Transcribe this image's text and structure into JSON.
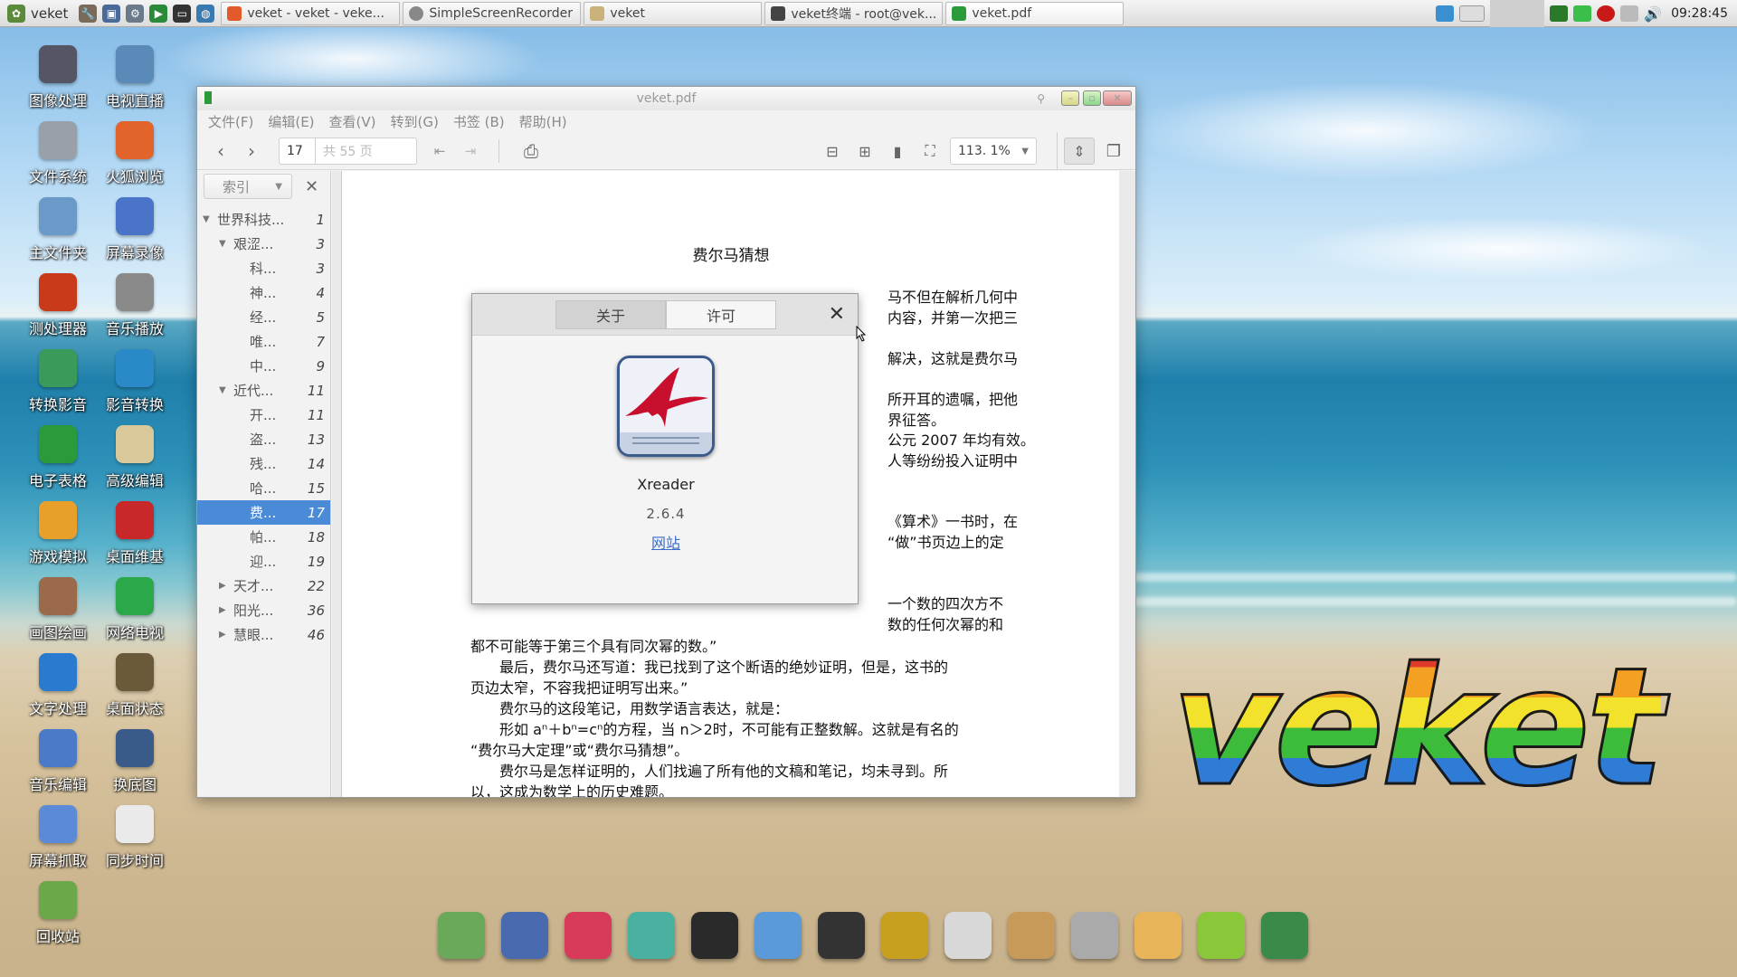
{
  "top_panel": {
    "start_label": "veket",
    "tasks": [
      {
        "label": "veket - veket - veke..."
      },
      {
        "label": "SimpleScreenRecorder"
      },
      {
        "label": "veket"
      },
      {
        "label": "veket终端 - root@vek..."
      },
      {
        "label": "veket.pdf"
      }
    ],
    "clock": "09:28:45"
  },
  "desktop_icons": [
    {
      "label": "图像处理",
      "icon": "image-editor-icon"
    },
    {
      "label": "电视直播",
      "icon": "tv-live-icon"
    },
    {
      "label": "文件系统",
      "icon": "drive-icon"
    },
    {
      "label": "火狐浏览",
      "icon": "firefox-icon"
    },
    {
      "label": "主文件夹",
      "icon": "home-folder-icon"
    },
    {
      "label": "屏幕录像",
      "icon": "screen-recorder-icon"
    },
    {
      "label": "测处理器",
      "icon": "cpu-test-icon"
    },
    {
      "label": "音乐播放",
      "icon": "music-player-icon"
    },
    {
      "label": "转换影音",
      "icon": "media-convert-icon"
    },
    {
      "label": "影音转换",
      "icon": "video-convert-icon"
    },
    {
      "label": "电子表格",
      "icon": "spreadsheet-icon"
    },
    {
      "label": "高级编辑",
      "icon": "text-editor-icon"
    },
    {
      "label": "游戏模拟",
      "icon": "game-emulator-icon"
    },
    {
      "label": "桌面维基",
      "icon": "desktop-wiki-icon"
    },
    {
      "label": "画图绘画",
      "icon": "paint-icon"
    },
    {
      "label": "网络电视",
      "icon": "network-tv-icon"
    },
    {
      "label": "文字处理",
      "icon": "word-processor-icon"
    },
    {
      "label": "桌面状态",
      "icon": "desktop-status-icon"
    },
    {
      "label": "音乐编辑",
      "icon": "audio-editor-icon"
    },
    {
      "label": "换底图",
      "icon": "wallpaper-icon"
    },
    {
      "label": "屏幕抓取",
      "icon": "screenshot-icon"
    },
    {
      "label": "同步时间",
      "icon": "calendar-sync-icon"
    },
    {
      "label": "回收站",
      "icon": "trash-icon"
    }
  ],
  "window": {
    "title": "veket.pdf",
    "menu": [
      "文件(F)",
      "编辑(E)",
      "查看(V)",
      "转到(G)",
      "书签 (B)",
      "帮助(H)"
    ],
    "toolbar": {
      "page_current": "17",
      "page_total": "共 55 页",
      "zoom": "113. 1%"
    },
    "sidebar": {
      "mode": "索引",
      "toc": [
        {
          "title": "世界科技...",
          "page": "1",
          "level": 0,
          "arrow": "▼"
        },
        {
          "title": "艰涩...",
          "page": "3",
          "level": 1,
          "arrow": "▼"
        },
        {
          "title": "科...",
          "page": "3",
          "level": 2,
          "arrow": ""
        },
        {
          "title": "神...",
          "page": "4",
          "level": 2,
          "arrow": ""
        },
        {
          "title": "经...",
          "page": "5",
          "level": 2,
          "arrow": ""
        },
        {
          "title": "唯...",
          "page": "7",
          "level": 2,
          "arrow": ""
        },
        {
          "title": "中...",
          "page": "9",
          "level": 2,
          "arrow": ""
        },
        {
          "title": "近代...",
          "page": "11",
          "level": 1,
          "arrow": "▼"
        },
        {
          "title": "开...",
          "page": "11",
          "level": 2,
          "arrow": ""
        },
        {
          "title": "盗...",
          "page": "13",
          "level": 2,
          "arrow": ""
        },
        {
          "title": "残...",
          "page": "14",
          "level": 2,
          "arrow": ""
        },
        {
          "title": "哈...",
          "page": "15",
          "level": 2,
          "arrow": ""
        },
        {
          "title": "费...",
          "page": "17",
          "level": 2,
          "arrow": "",
          "selected": true
        },
        {
          "title": "帕...",
          "page": "18",
          "level": 2,
          "arrow": ""
        },
        {
          "title": "迎...",
          "page": "19",
          "level": 2,
          "arrow": ""
        },
        {
          "title": "天才...",
          "page": "22",
          "level": 1,
          "arrow": "▶"
        },
        {
          "title": "阳光...",
          "page": "36",
          "level": 1,
          "arrow": "▶"
        },
        {
          "title": "慧眼...",
          "page": "46",
          "level": 1,
          "arrow": "▶"
        }
      ]
    },
    "document": {
      "title": "费尔马猜想",
      "right_fragments": [
        "马不但在解析几何中",
        "内容，并第一次把三",
        "解决，这就是费尔马",
        "所开耳的遗嘱，把他",
        "界征答。",
        "公元 2007 年均有效。",
        "人等纷纷投入证明中",
        "《算术》一书时，在",
        "“做”书页边上的定",
        "一个数的四次方不",
        "数的任何次幂的和"
      ],
      "lines": [
        "都不可能等于第三个具有同次幂的数。”",
        "　　最后，费尔马还写道：我已找到了这个断语的绝妙证明，但是，这书的",
        "页边太窄，不容我把证明写出来。”",
        "　　费尔马的这段笔记，用数学语言表达，就是：",
        "　　形如 aⁿ＋bⁿ=cⁿ的方程，当 n＞2时，不可能有正整数解。这就是有名的",
        "“费尔马大定理”或“费尔马猜想”。",
        "　　费尔马是怎样证明的，人们找遍了所有他的文稿和笔记，均未寻到。所",
        "以，这成为数学上的历史难题。"
      ]
    }
  },
  "about_dialog": {
    "tabs": [
      "关于",
      "许可"
    ],
    "app_name": "Xreader",
    "version": "2.6.4",
    "link": "网站"
  },
  "dock": [
    "file-manager-icon",
    "monitor-icon",
    "pet-icon",
    "notes-icon",
    "quicktime-icon",
    "network-icon",
    "penguin-icon",
    "notebook-icon",
    "chart-icon",
    "art-palette-icon",
    "usb-drive-icon",
    "veket-mascot-icon",
    "help-icon",
    "camera-icon"
  ],
  "brand": {
    "logo_text": "veket"
  }
}
